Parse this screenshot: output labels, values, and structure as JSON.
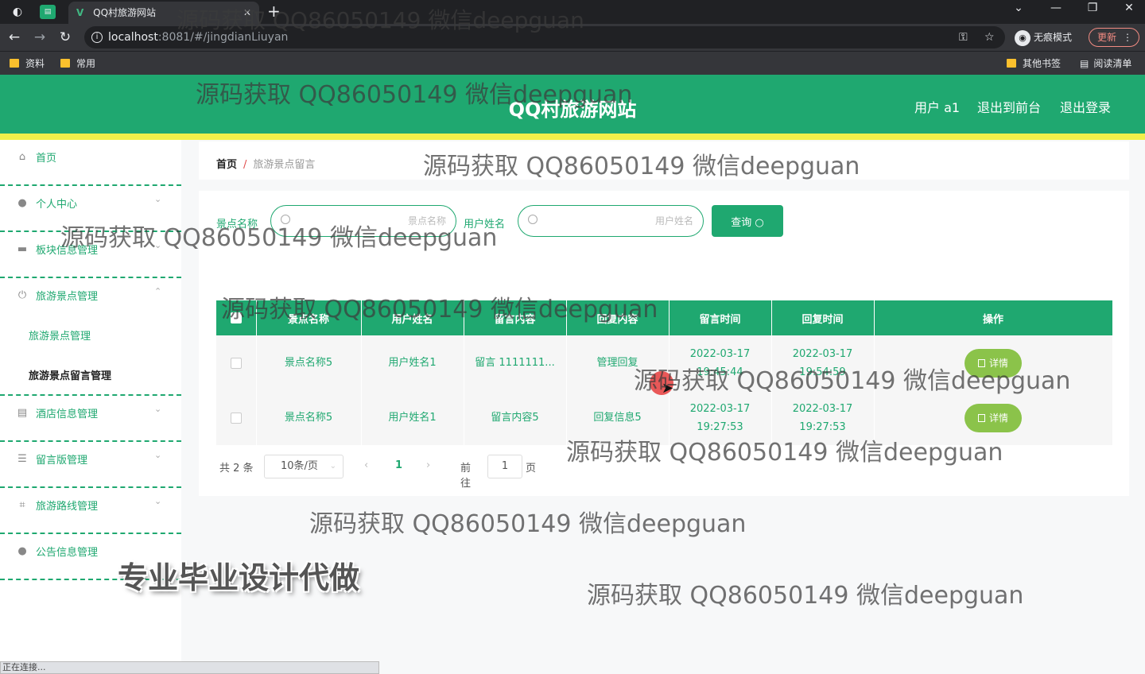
{
  "browser": {
    "tab_title": "QQ村旅游网站",
    "tab_logo": "V",
    "new_tab": "+",
    "url_host": "localhost",
    "url_path": ":8081/#/jingdianLiuyan",
    "incognito_label": "无痕模式",
    "update_label": "更新",
    "bookmarks": [
      "资料",
      "常用"
    ],
    "other_bookmarks": "其他书签",
    "reading_list": "阅读清单",
    "status_text": "正在连接..."
  },
  "header": {
    "title": "QQ村旅游网站",
    "user_label": "用户 a1",
    "back_to_front": "退出到前台",
    "logout": "退出登录"
  },
  "sidebar": {
    "items": [
      {
        "label": "首页",
        "icon": "home-icon"
      },
      {
        "label": "个人中心",
        "icon": "user-icon"
      },
      {
        "label": "板块信息管理",
        "icon": "monitor-icon"
      },
      {
        "label": "旅游景点管理",
        "icon": "power-icon"
      },
      {
        "label": "酒店信息管理",
        "icon": "document-icon"
      },
      {
        "label": "留言版管理",
        "icon": "list-icon"
      },
      {
        "label": "旅游路线管理",
        "icon": "crop-icon"
      },
      {
        "label": "公告信息管理",
        "icon": "user-icon"
      }
    ],
    "sub_items": [
      "旅游景点管理",
      "旅游景点留言管理"
    ]
  },
  "breadcrumb": {
    "home": "首页",
    "separator": "/",
    "current": "旅游景点留言"
  },
  "search": {
    "name_label": "景点名称",
    "name_placeholder": "景点名称",
    "user_label": "用户姓名",
    "user_placeholder": "用户姓名",
    "query_button": "查询 ○"
  },
  "table": {
    "columns": [
      "",
      "景点名称",
      "用户姓名",
      "留言内容",
      "回复内容",
      "留言时间",
      "回复时间",
      "操作"
    ],
    "rows": [
      {
        "name": "景点名称5",
        "user": "用户姓名1",
        "message": "留言 1111111...",
        "reply": "管理回复",
        "msg_time": "2022-03-17 19:45:44",
        "reply_time": "2022-03-17 19:54:59",
        "action": "详情"
      },
      {
        "name": "景点名称5",
        "user": "用户姓名1",
        "message": "留言内容5",
        "reply": "回复信息5",
        "msg_time": "2022-03-17 19:27:53",
        "reply_time": "2022-03-17 19:27:53",
        "action": "详情"
      }
    ]
  },
  "pagination": {
    "total": "共 2 条",
    "page_size": "10条/页",
    "current_page": "1",
    "goto_label": "前往",
    "goto_value": "1",
    "page_unit": "页"
  },
  "watermarks": [
    "源码获取 QQ86050149 微信deepguan",
    "源码获取 QQ86050149 微信deepguan",
    "源码获取 QQ86050149 微信deepguan",
    "源码获取 QQ86050149 微信deepguan",
    "源码获取 QQ86050149 微信deepguan",
    "源码获取 QQ86050149 微信deepguan",
    "源码获取 QQ86050149 微信deepguan",
    "源码获取 QQ86050149 微信deepguan",
    "源码获取 QQ86050149 微信deepguan"
  ],
  "promo_text": "专业毕业设计代做",
  "colors": {
    "primary": "#1fa870",
    "accent_strip": "#f0f04a",
    "detail_button": "#8bc34a"
  }
}
